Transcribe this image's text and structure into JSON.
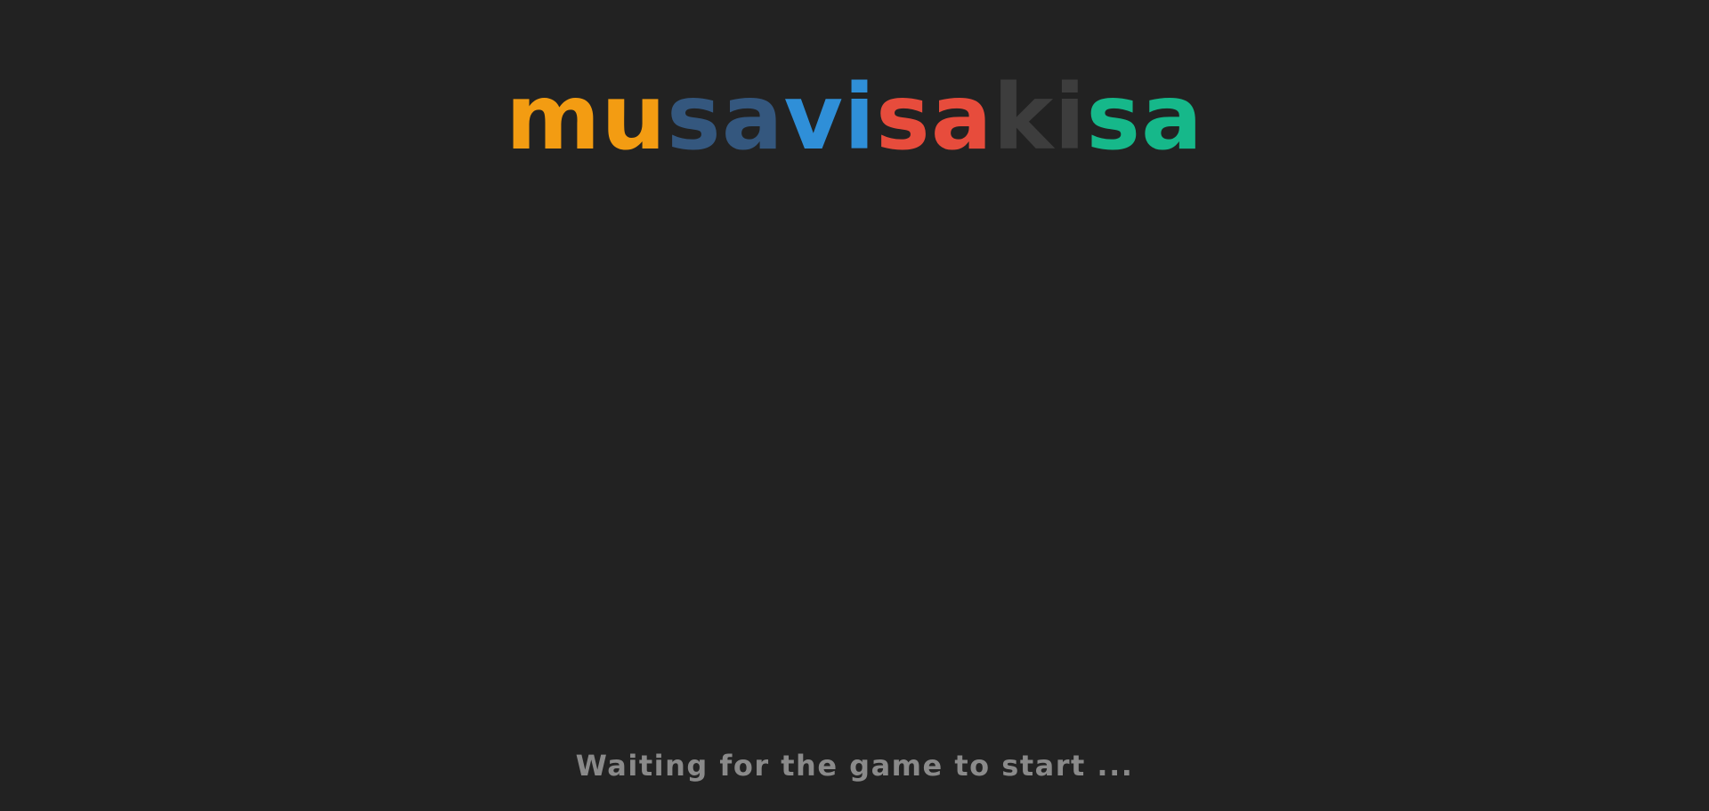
{
  "logo": {
    "segments": [
      {
        "text": "mu",
        "color": "#f39c12"
      },
      {
        "text": "sa",
        "color": "#34577e"
      },
      {
        "text": "vi",
        "color": "#2f8fd8"
      },
      {
        "text": "sa",
        "color": "#e74c3c"
      },
      {
        "text": "ki",
        "color": "#3d3d3d"
      },
      {
        "text": "sa",
        "color": "#16b88a"
      }
    ]
  },
  "status": {
    "text": "Waiting for the game to start ..."
  },
  "colors": {
    "background": "#222222",
    "status_text": "#8a8a8a"
  }
}
